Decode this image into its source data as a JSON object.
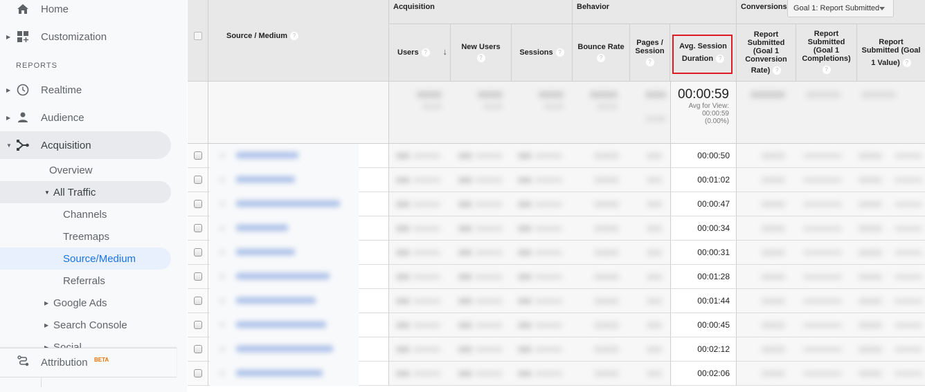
{
  "sidebar": {
    "home": "Home",
    "customization": "Customization",
    "reports_label": "REPORTS",
    "realtime": "Realtime",
    "audience": "Audience",
    "acquisition": "Acquisition",
    "overview": "Overview",
    "all_traffic": "All Traffic",
    "channels": "Channels",
    "treemaps": "Treemaps",
    "source_medium": "Source/Medium",
    "referrals": "Referrals",
    "google_ads": "Google Ads",
    "search_console": "Search Console",
    "social": "Social",
    "attribution": "Attribution",
    "attribution_badge": "BETA"
  },
  "table": {
    "groups": {
      "acquisition": "Acquisition",
      "behavior": "Behavior",
      "conversions": "Conversions"
    },
    "goal_dropdown": "Goal 1: Report Submitted",
    "columns": {
      "source_medium": "Source / Medium",
      "users": "Users",
      "new_users": "New Users",
      "sessions": "Sessions",
      "bounce_rate": "Bounce Rate",
      "pages_session_1": "Pages /",
      "pages_session_2": "Session",
      "avg_session_1": "Avg. Session",
      "avg_session_2": "Duration",
      "conv_rate_1": "Report",
      "conv_rate_2": "Submitted",
      "conv_rate_3": "(Goal 1",
      "conv_rate_4": "Conversion",
      "conv_rate_5": "Rate)",
      "completions_1": "Report",
      "completions_2": "Submitted",
      "completions_3": "(Goal 1",
      "completions_4": "Completions)",
      "value_1": "Report",
      "value_2": "Submitted (Goal",
      "value_3": "1 Value)"
    },
    "help_glyph": "?",
    "sort_glyph": "↓",
    "totals": {
      "avg_session_duration": "00:00:59",
      "avg_for_view_label": "Avg for View:",
      "avg_for_view_value": "00:00:59",
      "avg_for_view_pct": "(0.00%)"
    },
    "rows": [
      {
        "avg_session_duration": "00:00:50"
      },
      {
        "avg_session_duration": "00:01:02"
      },
      {
        "avg_session_duration": "00:00:47"
      },
      {
        "avg_session_duration": "00:00:34"
      },
      {
        "avg_session_duration": "00:00:31"
      },
      {
        "avg_session_duration": "00:01:28"
      },
      {
        "avg_session_duration": "00:01:44"
      },
      {
        "avg_session_duration": "00:00:45"
      },
      {
        "avg_session_duration": "00:02:12"
      },
      {
        "avg_session_duration": "00:02:06"
      }
    ]
  },
  "colors": {
    "highlight_border": "#e01b24",
    "selected_nav": "#1a73e8",
    "beta_badge": "#e8710a"
  }
}
